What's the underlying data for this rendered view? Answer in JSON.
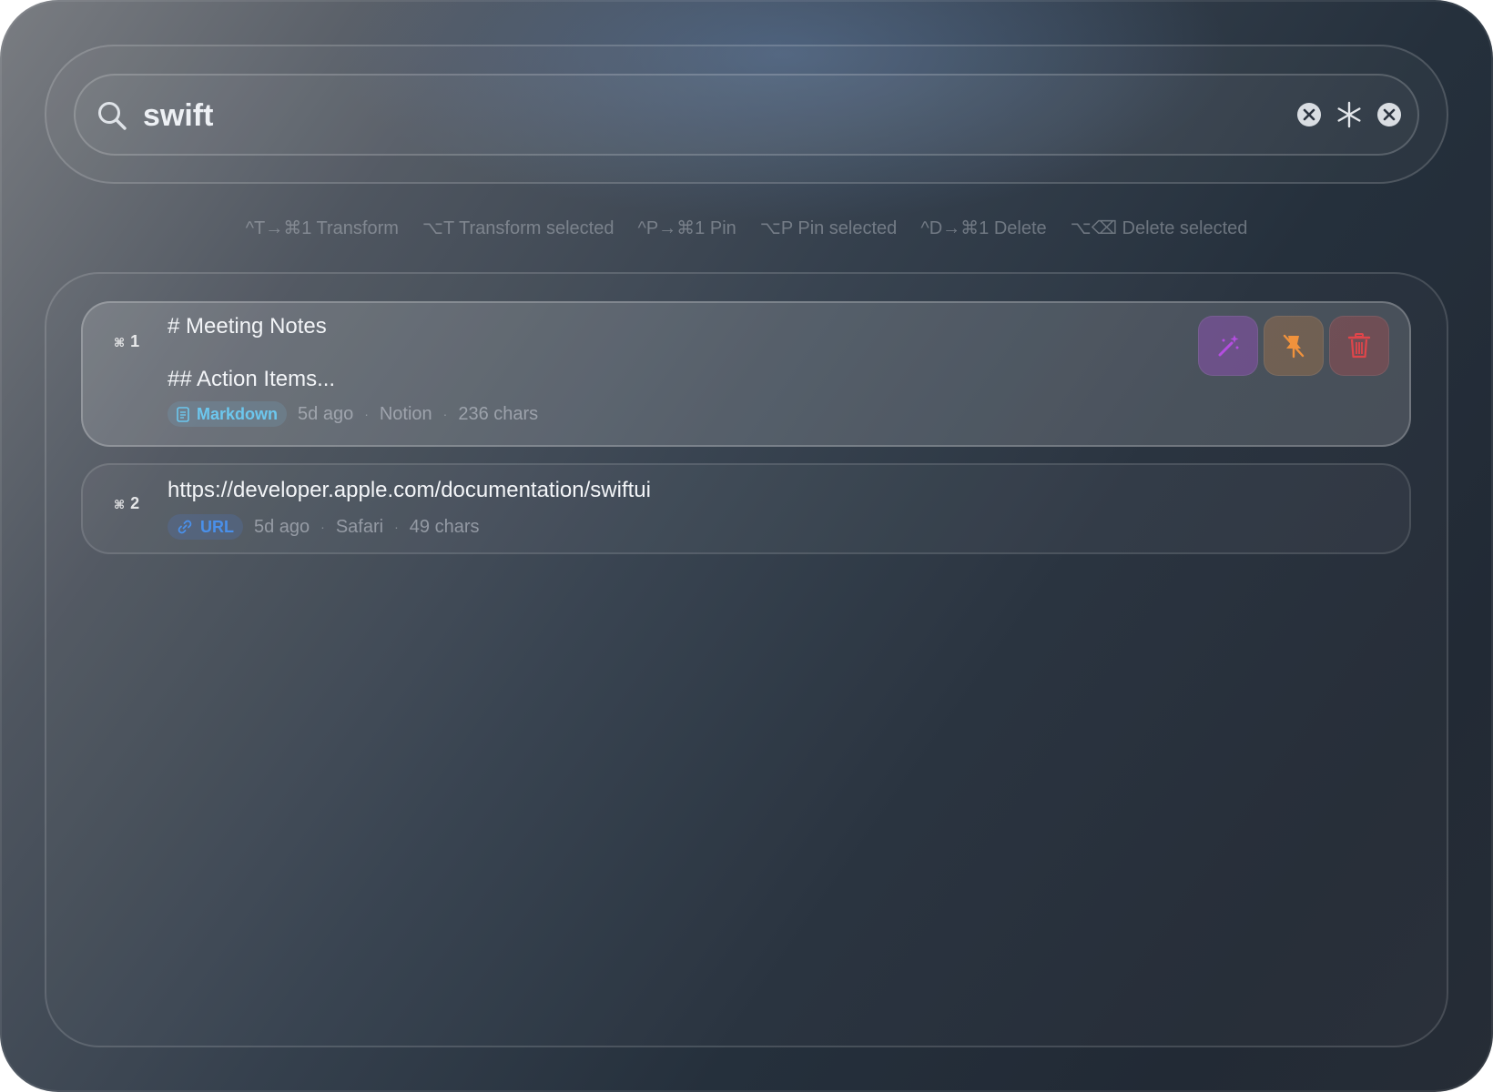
{
  "search": {
    "query": "swift"
  },
  "hints": [
    {
      "text": "^T→⌘1 Transform"
    },
    {
      "text": "⌥T Transform selected"
    },
    {
      "text": "^P→⌘1 Pin"
    },
    {
      "text": "⌥P Pin selected"
    },
    {
      "text": "^D→⌘1 Delete"
    },
    {
      "text": "⌥⌫ Delete selected"
    }
  ],
  "results": [
    {
      "shortcut_symbol": "⌘",
      "shortcut_number": "1",
      "line1": "# Meeting Notes",
      "line2": "## Action Items...",
      "type": "Markdown",
      "age": "5d ago",
      "app": "Notion",
      "size": "236 chars",
      "selected": true
    },
    {
      "shortcut_symbol": "⌘",
      "shortcut_number": "2",
      "line1": "https://developer.apple.com/documentation/swiftui",
      "type": "URL",
      "age": "5d ago",
      "app": "Safari",
      "size": "49 chars",
      "selected": false
    }
  ],
  "dot_separator": "·",
  "colors": {
    "markdown_badge": "#6cc7ee",
    "url_badge": "#4a90ea",
    "transform_accent": "#b44ee0",
    "pin_accent": "#f0923c",
    "delete_accent": "#e0454a"
  },
  "icons": {
    "search": "search-icon",
    "clear": "clear-icon",
    "regex": "asterisk-icon",
    "close": "close-icon",
    "transform": "magic-wand-icon",
    "pin": "pin-slash-icon",
    "delete": "trash-icon",
    "markdown": "document-icon",
    "url": "link-icon"
  }
}
